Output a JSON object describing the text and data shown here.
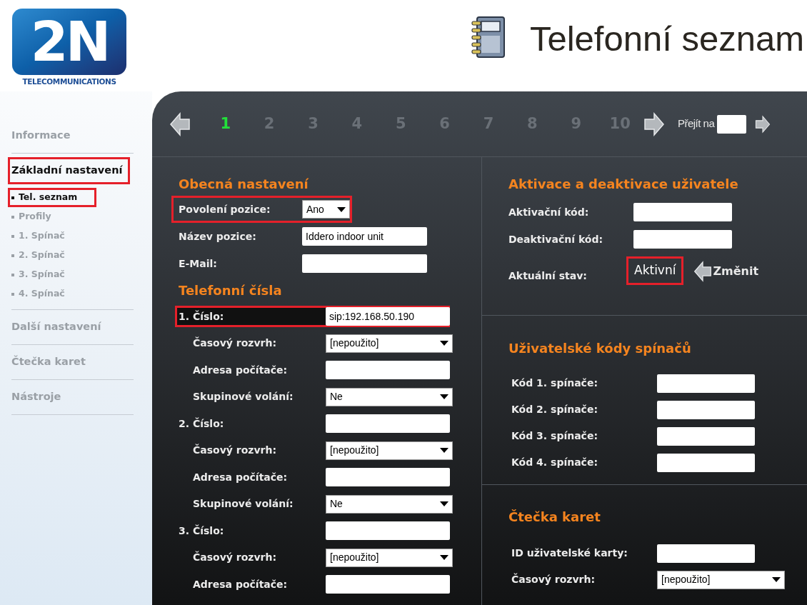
{
  "logo": {
    "mark": "2N",
    "tagline": "TELECOMMUNICATIONS"
  },
  "page_title": "Telefonní seznam",
  "sidebar": {
    "items": [
      {
        "label": "Informace",
        "selected": false,
        "highlighted": false
      },
      {
        "label": "Základní nastavení",
        "selected": true,
        "highlighted": true,
        "children": [
          {
            "label": "Tel. seznam",
            "selected": true,
            "highlighted": true
          },
          {
            "label": "Profily",
            "selected": false,
            "highlighted": false
          },
          {
            "label": "1. Spínač",
            "selected": false,
            "highlighted": false
          },
          {
            "label": "2. Spínač",
            "selected": false,
            "highlighted": false
          },
          {
            "label": "3. Spínač",
            "selected": false,
            "highlighted": false
          },
          {
            "label": "4. Spínač",
            "selected": false,
            "highlighted": false
          }
        ]
      },
      {
        "label": "Další nastavení",
        "selected": false,
        "highlighted": false
      },
      {
        "label": "Čtečka karet",
        "selected": false,
        "highlighted": false
      },
      {
        "label": "Nástroje",
        "selected": false,
        "highlighted": false
      }
    ]
  },
  "pager": {
    "pages": [
      {
        "label": "1",
        "selected": true
      },
      {
        "label": "2",
        "selected": false
      },
      {
        "label": "3",
        "selected": false
      },
      {
        "label": "4",
        "selected": false
      },
      {
        "label": "5",
        "selected": false
      },
      {
        "label": "6",
        "selected": false
      },
      {
        "label": "7",
        "selected": false
      },
      {
        "label": "8",
        "selected": false
      },
      {
        "label": "9",
        "selected": false
      },
      {
        "label": "10",
        "selected": false
      }
    ],
    "goto_label": "Přejít na"
  },
  "general": {
    "title": "Obecná nastavení",
    "rows": [
      {
        "label": "Povolení pozice:",
        "kind": "select",
        "value": "Ano",
        "highlighted": true
      },
      {
        "label": "Název pozice:",
        "kind": "input",
        "value": "Iddero indoor unit",
        "highlighted": false
      },
      {
        "label": "E-Mail:",
        "kind": "input",
        "highlighted": false
      }
    ]
  },
  "phone_numbers": {
    "title": "Telefonní čísla",
    "rows": [
      {
        "label": "1. Číslo:",
        "kind": "input",
        "value": "sip:192.168.50.190",
        "highlighted": true,
        "children": [
          {
            "label": "Časový rozvrh:",
            "kind": "select",
            "value": "[nepoužito]"
          },
          {
            "label": "Adresa počítače:",
            "kind": "input"
          },
          {
            "label": "Skupinové volání:",
            "kind": "select",
            "value": "Ne"
          }
        ]
      },
      {
        "label": "2. Číslo:",
        "kind": "input",
        "highlighted": false,
        "children": [
          {
            "label": "Časový rozvrh:",
            "kind": "select",
            "value": "[nepoužito]"
          },
          {
            "label": "Adresa počítače:",
            "kind": "input"
          },
          {
            "label": "Skupinové volání:",
            "kind": "select",
            "value": "Ne"
          }
        ]
      },
      {
        "label": "3. Číslo:",
        "kind": "input",
        "highlighted": false,
        "children": [
          {
            "label": "Časový rozvrh:",
            "kind": "select",
            "value": "[nepoužito]"
          },
          {
            "label": "Adresa počítače:",
            "kind": "input"
          }
        ]
      }
    ]
  },
  "activation": {
    "title": "Aktivace a deaktivace uživatele",
    "rows": [
      {
        "label": "Aktivační kód:",
        "kind": "input"
      },
      {
        "label": "Deaktivační kód:",
        "kind": "input"
      }
    ],
    "status_label": "Aktuální stav:",
    "status": "Aktivní",
    "status_highlighted": true,
    "change_button": "Změnit"
  },
  "switch_codes": {
    "title": "Uživatelské kódy spínačů",
    "rows": [
      {
        "label": "Kód 1. spínače:",
        "kind": "input"
      },
      {
        "label": "Kód 2. spínače:",
        "kind": "input"
      },
      {
        "label": "Kód 3. spínače:",
        "kind": "input"
      },
      {
        "label": "Kód 4. spínače:",
        "kind": "input"
      }
    ]
  },
  "card_reader": {
    "title": "Čtečka karet",
    "rows": [
      {
        "label": "ID uživatelské karty:",
        "kind": "input"
      },
      {
        "label": "Časový rozvrh:",
        "kind": "select",
        "value": "[nepoužito]"
      }
    ]
  }
}
